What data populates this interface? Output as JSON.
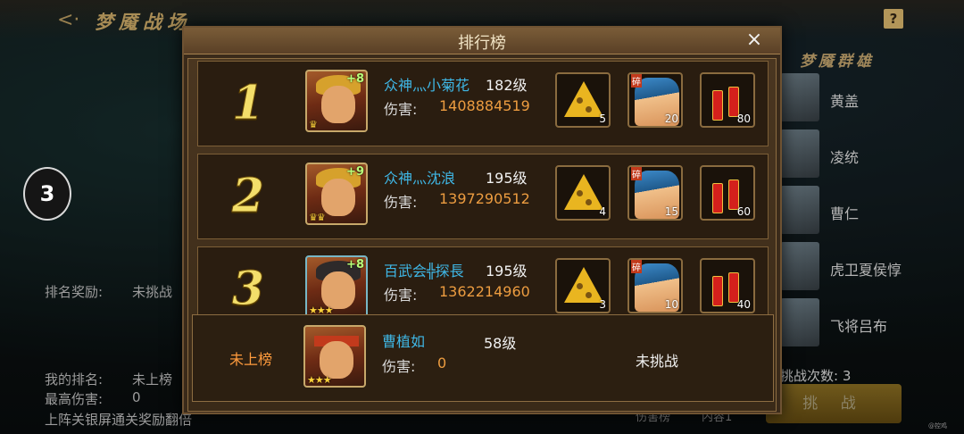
{
  "background": {
    "title": "梦魇战场",
    "help_icon": "?",
    "round_badge": "3",
    "rank_reward_label": "排名奖励:",
    "rank_reward_value": "未挑战",
    "my_rank_label": "我的排名:",
    "my_rank_value": "未上榜",
    "best_damage_label": "最高伤害:",
    "best_damage_value": "0",
    "bonus_text": "上阵关银屏通关奖励翻倍",
    "boss_panel_title": "梦魇群雄",
    "bosses": [
      {
        "name": "黄盖"
      },
      {
        "name": "凌统"
      },
      {
        "name": "曹仁"
      },
      {
        "name": "虎卫夏侯惇"
      },
      {
        "name": "飞将吕布"
      }
    ],
    "challenge_count_label": "挑战次数: 3",
    "challenge_button": "挑 战",
    "tab_left": "伤害榜",
    "tab_right": "内容1",
    "watermark": "@控鸡"
  },
  "modal": {
    "title": "排行榜",
    "close_icon": "×",
    "damage_label": "伤害:",
    "entries": [
      {
        "rank": "1",
        "name": "众神灬小菊花",
        "level": "182级",
        "damage": "1408884519",
        "hero_plus": "+8",
        "hero_stars": "♛",
        "rewards": [
          "5",
          "20",
          "80"
        ]
      },
      {
        "rank": "2",
        "name": "众神灬沈浪",
        "level": "195级",
        "damage": "1397290512",
        "hero_plus": "+9",
        "hero_stars": "♛♛",
        "rewards": [
          "4",
          "15",
          "60"
        ]
      },
      {
        "rank": "3",
        "name": "百武会╬探長",
        "level": "195级",
        "damage": "1362214960",
        "hero_plus": "+8",
        "hero_stars": "★★★",
        "rewards": [
          "3",
          "10",
          "40"
        ]
      }
    ],
    "mine": {
      "rank": "未上榜",
      "name": "曹植如",
      "level": "58级",
      "damage": "0",
      "hero_stars": "★★★",
      "status": "未挑战"
    },
    "reward_shard_tag": "碎"
  },
  "colors": {
    "player_name": "#3fb7e6",
    "damage_value": "#ec9c40",
    "rank_digit": "#f3de6a",
    "not_ranked": "#ff9b3d"
  }
}
